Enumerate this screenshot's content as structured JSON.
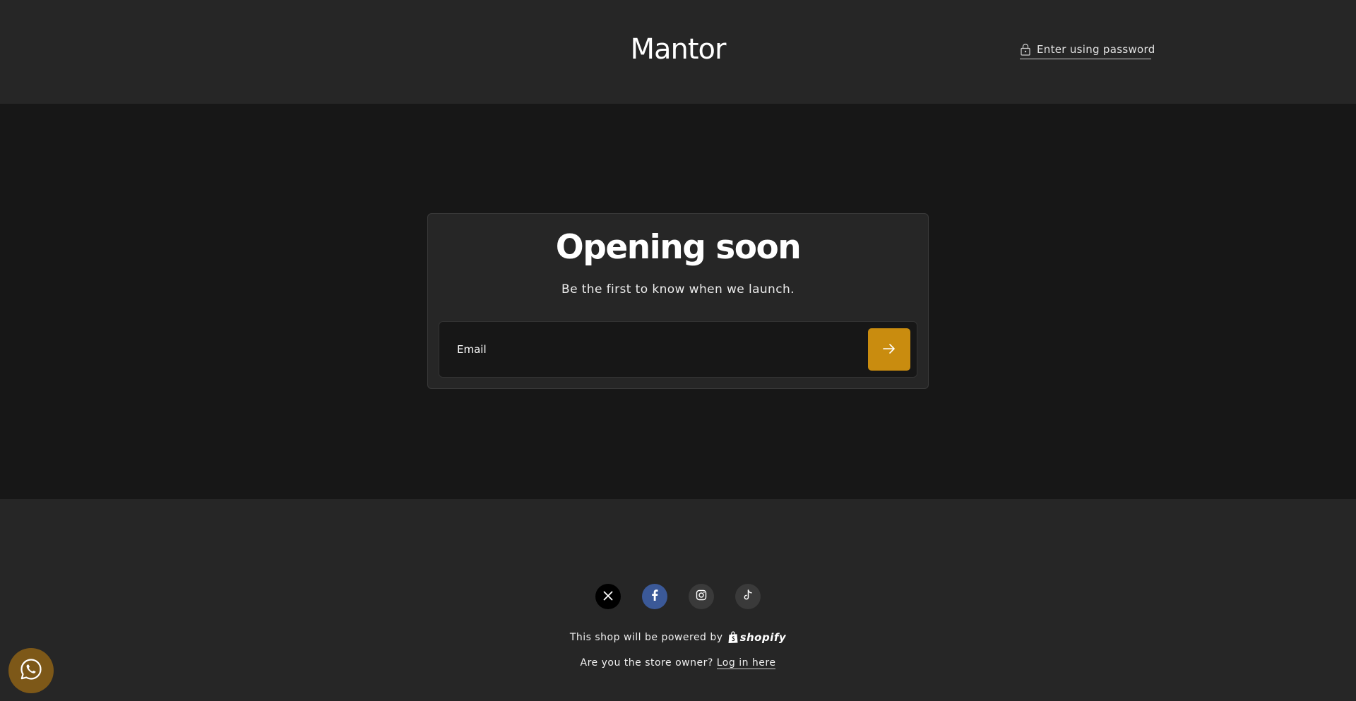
{
  "header": {
    "brand": "Mantor",
    "password_link": "Enter using password"
  },
  "main": {
    "heading": "Opening soon",
    "subheading": "Be the first to know when we launch.",
    "email_placeholder": "Email"
  },
  "footer": {
    "social": [
      {
        "name": "X",
        "icon": "x-icon",
        "bg": "#000000"
      },
      {
        "name": "Facebook",
        "icon": "facebook-icon",
        "bg": "#3b5998"
      },
      {
        "name": "Instagram",
        "icon": "instagram-icon",
        "bg": "#3a3a3a"
      },
      {
        "name": "TikTok",
        "icon": "tiktok-icon",
        "bg": "#3a3a3a"
      }
    ],
    "powered_text": "This shop will be powered by",
    "shopify_label": "shopify",
    "owner_text": "Are you the store owner?",
    "login_link": "Log in here"
  },
  "colors": {
    "accent": "#c98c0f",
    "header_bg": "#262626",
    "main_bg": "#171717",
    "whatsapp_bg": "#7d5818"
  }
}
